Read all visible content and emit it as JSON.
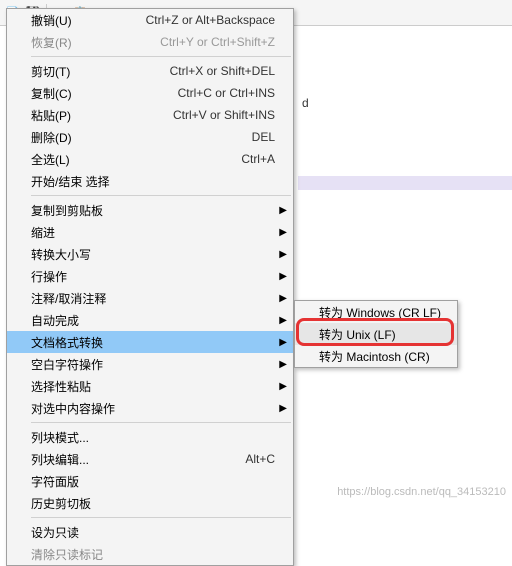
{
  "toolbar": {
    "icons": [
      "new",
      "open",
      "save",
      "print",
      "cut",
      "copy",
      "paste",
      "undo",
      "redo",
      "find"
    ]
  },
  "editor": {
    "hint_char": "d"
  },
  "menu": {
    "groups": [
      [
        {
          "id": "undo",
          "label": "撤销(U)",
          "shortcut": "Ctrl+Z or Alt+Backspace",
          "disabled": false,
          "sub": false
        },
        {
          "id": "redo",
          "label": "恢复(R)",
          "shortcut": "Ctrl+Y or Ctrl+Shift+Z",
          "disabled": true,
          "sub": false
        }
      ],
      [
        {
          "id": "cut",
          "label": "剪切(T)",
          "shortcut": "Ctrl+X or Shift+DEL",
          "disabled": false,
          "sub": false
        },
        {
          "id": "copy",
          "label": "复制(C)",
          "shortcut": "Ctrl+C or Ctrl+INS",
          "disabled": false,
          "sub": false
        },
        {
          "id": "paste",
          "label": "粘贴(P)",
          "shortcut": "Ctrl+V or Shift+INS",
          "disabled": false,
          "sub": false
        },
        {
          "id": "delete",
          "label": "删除(D)",
          "shortcut": "DEL",
          "disabled": false,
          "sub": false
        },
        {
          "id": "select-all",
          "label": "全选(L)",
          "shortcut": "Ctrl+A",
          "disabled": false,
          "sub": false
        },
        {
          "id": "begin-end-select",
          "label": "开始/结束 选择",
          "shortcut": "",
          "disabled": false,
          "sub": false
        }
      ],
      [
        {
          "id": "copy-clipboard",
          "label": "复制到剪贴板",
          "shortcut": "",
          "disabled": false,
          "sub": true
        },
        {
          "id": "indent",
          "label": "缩进",
          "shortcut": "",
          "disabled": false,
          "sub": true
        },
        {
          "id": "case",
          "label": "转换大小写",
          "shortcut": "",
          "disabled": false,
          "sub": true
        },
        {
          "id": "line-ops",
          "label": "行操作",
          "shortcut": "",
          "disabled": false,
          "sub": true
        },
        {
          "id": "comment",
          "label": "注释/取消注释",
          "shortcut": "",
          "disabled": false,
          "sub": true
        },
        {
          "id": "autocomplete",
          "label": "自动完成",
          "shortcut": "",
          "disabled": false,
          "sub": true
        },
        {
          "id": "eol-convert",
          "label": "文档格式转换",
          "shortcut": "",
          "disabled": false,
          "sub": true,
          "highlight": true
        },
        {
          "id": "blank-ops",
          "label": "空白字符操作",
          "shortcut": "",
          "disabled": false,
          "sub": true
        },
        {
          "id": "paste-special",
          "label": "选择性粘贴",
          "shortcut": "",
          "disabled": false,
          "sub": true
        },
        {
          "id": "on-selection",
          "label": "对选中内容操作",
          "shortcut": "",
          "disabled": false,
          "sub": true
        }
      ],
      [
        {
          "id": "column-mode",
          "label": "列块模式...",
          "shortcut": "",
          "disabled": false,
          "sub": false
        },
        {
          "id": "column-editor",
          "label": "列块编辑...",
          "shortcut": "Alt+C",
          "disabled": false,
          "sub": false
        },
        {
          "id": "char-panel",
          "label": "字符面版",
          "shortcut": "",
          "disabled": false,
          "sub": false
        },
        {
          "id": "clipboard-history",
          "label": "历史剪切板",
          "shortcut": "",
          "disabled": false,
          "sub": false
        }
      ],
      [
        {
          "id": "set-readonly",
          "label": "设为只读",
          "shortcut": "",
          "disabled": false,
          "sub": false
        },
        {
          "id": "clear-readonly",
          "label": "清除只读标记",
          "shortcut": "",
          "disabled": true,
          "sub": false
        }
      ]
    ]
  },
  "submenu": {
    "items": [
      {
        "id": "to-windows",
        "label": "转为 Windows (CR LF)",
        "hover": false
      },
      {
        "id": "to-unix",
        "label": "转为 Unix (LF)",
        "hover": true
      },
      {
        "id": "to-mac",
        "label": "转为 Macintosh (CR)",
        "hover": false
      }
    ]
  },
  "watermark": "https://blog.csdn.net/qq_34153210"
}
